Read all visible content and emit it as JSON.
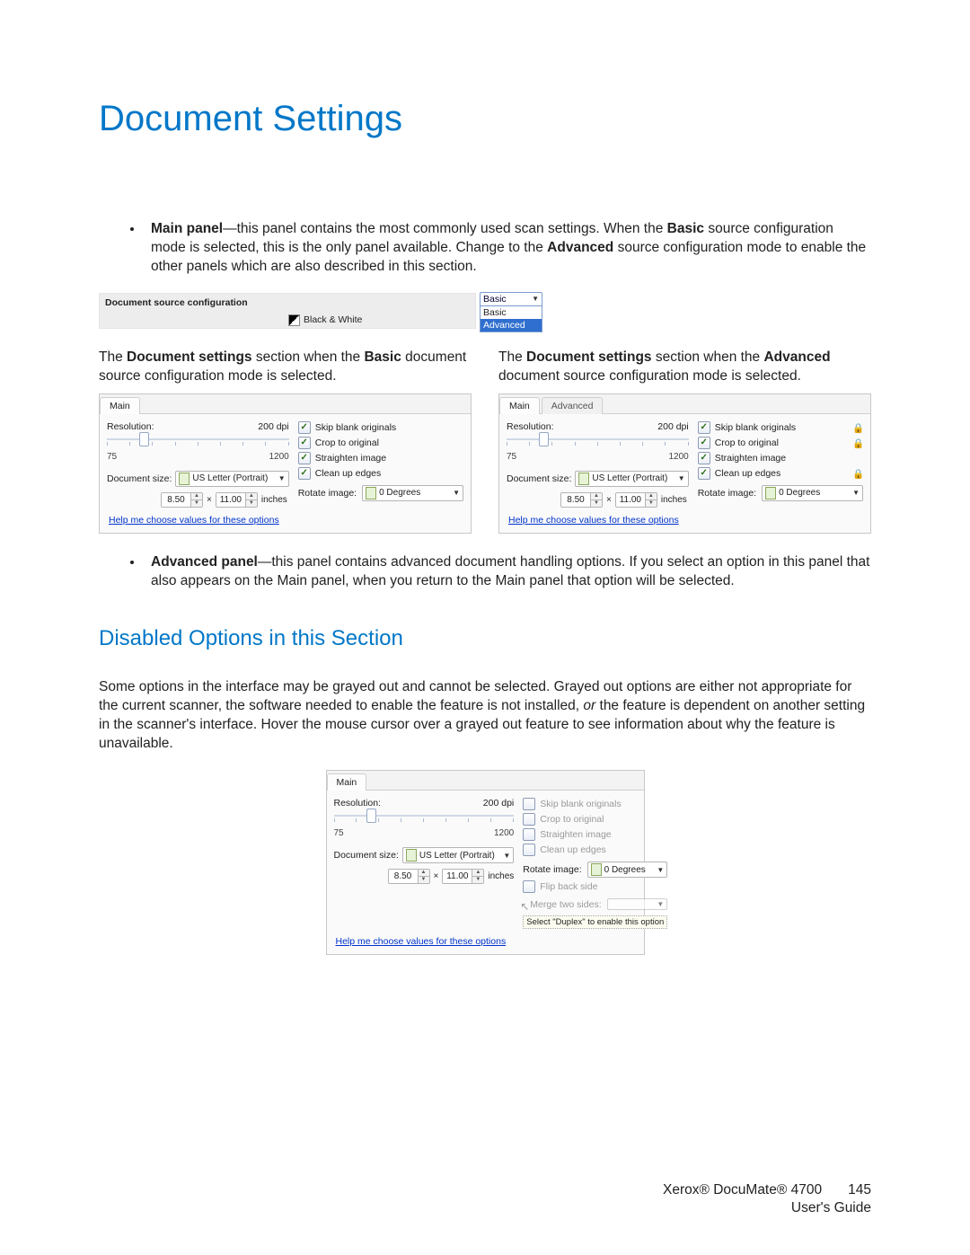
{
  "title": "Document Settings",
  "bullets": {
    "main": {
      "lead": "Main panel",
      "text": "—this panel contains the most commonly used scan settings. When the ",
      "bold1": "Basic",
      "text2": " source configuration mode is selected, this is the only panel available. Change to the ",
      "bold2": "Advanced",
      "text3": " source configuration mode to enable the other panels which are also described in this section."
    },
    "advanced": {
      "lead": "Advanced panel",
      "text": "—this panel contains advanced document handling options. If you select an option in this panel that also appears on the Main panel, when you return to the Main panel that option will be selected."
    }
  },
  "config_box": {
    "title": "Document source configuration",
    "mode_label": "Black & White",
    "dropdown": {
      "current": "Basic",
      "options": [
        "Basic",
        "Advanced"
      ]
    }
  },
  "captions": {
    "basic1": "The ",
    "basic_bold": "Document settings",
    "basic2": " section when the ",
    "basic_mode": "Basic",
    "basic3": " document source configuration mode is selected.",
    "adv_mode": "Advanced"
  },
  "panel": {
    "tabs": {
      "main": "Main",
      "advanced": "Advanced"
    },
    "resolution": {
      "label": "Resolution:",
      "value": "200 dpi",
      "min": "75",
      "max": "1200"
    },
    "docsize": {
      "label": "Document size:",
      "preset": "US Letter (Portrait)"
    },
    "dims": {
      "w": "8.50",
      "h": "11.00",
      "mult": "×",
      "unit": "inches"
    },
    "checks": {
      "skip": "Skip blank originals",
      "crop": "Crop to original",
      "straighten": "Straighten image",
      "clean": "Clean up edges",
      "flip": "Flip back side",
      "merge": "Merge two sides:"
    },
    "rotate": {
      "label": "Rotate image:",
      "value": "0 Degrees"
    },
    "help": "Help me choose values for these options",
    "tooltip": "Select \"Duplex\" to enable this option"
  },
  "subhead": "Disabled Options in this Section",
  "disabled_text": {
    "p1": "Some options in the interface may be grayed out and cannot be selected. Grayed out options are either not appropriate for the current scanner, the software needed to enable the feature is not installed, ",
    "p1_i": "or",
    "p1b": " the feature is dependent on another setting in the scanner's interface. Hover the mouse cursor over a grayed out feature to see information about why the feature is unavailable."
  },
  "footer": {
    "brand": "Xerox® DocuMate® 4700",
    "page": "145",
    "guide": "User's Guide"
  }
}
